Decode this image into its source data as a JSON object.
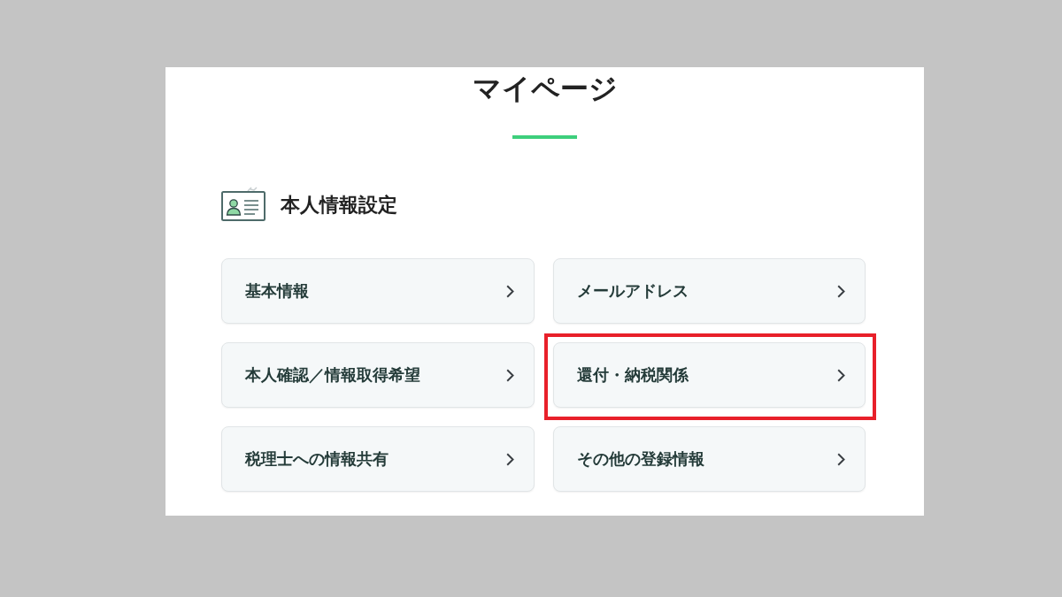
{
  "page": {
    "title": "マイページ"
  },
  "section": {
    "title": "本人情報設定"
  },
  "items": [
    {
      "label": "基本情報",
      "highlighted": false
    },
    {
      "label": "メールアドレス",
      "highlighted": false
    },
    {
      "label": "本人確認／情報取得希望",
      "highlighted": false
    },
    {
      "label": "還付・納税関係",
      "highlighted": true
    },
    {
      "label": "税理士への情報共有",
      "highlighted": false
    },
    {
      "label": "その他の登録情報",
      "highlighted": false
    }
  ]
}
